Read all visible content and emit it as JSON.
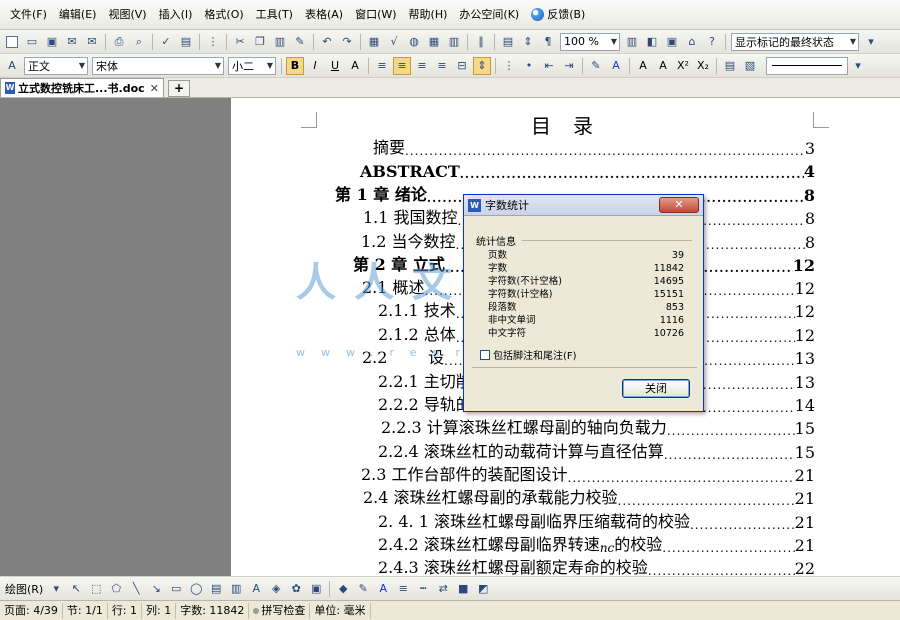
{
  "menu": [
    "文件(F)",
    "编辑(E)",
    "视图(V)",
    "插入(I)",
    "格式(O)",
    "工具(T)",
    "表格(A)",
    "窗口(W)",
    "帮助(H)",
    "办公空间(K)"
  ],
  "menu_feedback": "反馈(B)",
  "toolbar": {
    "zoom": "100 %",
    "markup_display": "显示标记的最终状态",
    "style": "正文",
    "font": "宋体",
    "size": "小二",
    "bold_label": "B",
    "italic_label": "I",
    "underline_label": "U"
  },
  "tab": {
    "title": "立式数控铣床工...书.doc *",
    "new_tab_label": "+"
  },
  "document": {
    "toc_title": "目录",
    "entries": [
      {
        "text": "摘要",
        "page": "3"
      },
      {
        "text": "ABSTRACT",
        "page": "4"
      },
      {
        "text": "第 1 章  绪论",
        "page": "8"
      },
      {
        "text": "1.1 我国数控",
        "page": "8"
      },
      {
        "text": "1.2 当今数控",
        "page": "8"
      },
      {
        "text": "第 2 章  立式",
        "page": "12"
      },
      {
        "text": "2.1 概述",
        "page": "12"
      },
      {
        "text": "2.1.1 技术",
        "page": "12"
      },
      {
        "text": "2.1.2 总体",
        "page": "12"
      },
      {
        "text": "2.2        设",
        "page": "13"
      },
      {
        "text": "2.2.1 主切削",
        "page": "13"
      },
      {
        "text": "2.2.2 导轨的",
        "page": "14"
      },
      {
        "text": "2.2.3 计算滚珠丝杠螺母副的轴向负载力",
        "page": "15"
      },
      {
        "text": "2.2.4 滚珠丝杠的动载荷计算与直径估算",
        "page": "15"
      },
      {
        "text": "2.3 工作台部件的装配图设计",
        "page": "21"
      },
      {
        "text": "2.4 滚珠丝杠螺母副的承载能力校验",
        "page": "21"
      },
      {
        "text": "2. 4. 1 滚珠丝杠螺母副临界压缩载荷的校验",
        "page": "21"
      },
      {
        "text": "2.4.2 滚珠丝杠螺母副临界转速",
        "page": "21",
        "var": "nc",
        "after": "的校验"
      },
      {
        "text": "2.4.3 滚珠丝杠螺母副额定寿命的校验",
        "page": "22"
      }
    ],
    "watermark": "人人文库",
    "watermark_url": "www.renrendoc.com"
  },
  "dialog": {
    "title": "字数统计",
    "group": "统计信息",
    "stats": [
      {
        "label": "页数",
        "value": "39"
      },
      {
        "label": "字数",
        "value": "11842"
      },
      {
        "label": "字符数(不计空格)",
        "value": "14695"
      },
      {
        "label": "字符数(计空格)",
        "value": "15151"
      },
      {
        "label": "段落数",
        "value": "853"
      },
      {
        "label": "非中文单词",
        "value": "1116"
      },
      {
        "label": "中文字符",
        "value": "10726"
      }
    ],
    "include_notes": "包括脚注和尾注(F)",
    "close_button": "关闭",
    "close_x": "✕"
  },
  "drawbar": {
    "label": "绘图(R)"
  },
  "status": {
    "page": "页面: 4/39",
    "section": "节: 1/1",
    "row": "行: 1",
    "col": "列: 1",
    "words": "字数: 11842",
    "spell": "拼写检查",
    "unit": "单位: 毫米"
  },
  "colors": {
    "accent": "#0831d9",
    "highlight": "#f5d88a",
    "watermark": "#5096d2"
  }
}
